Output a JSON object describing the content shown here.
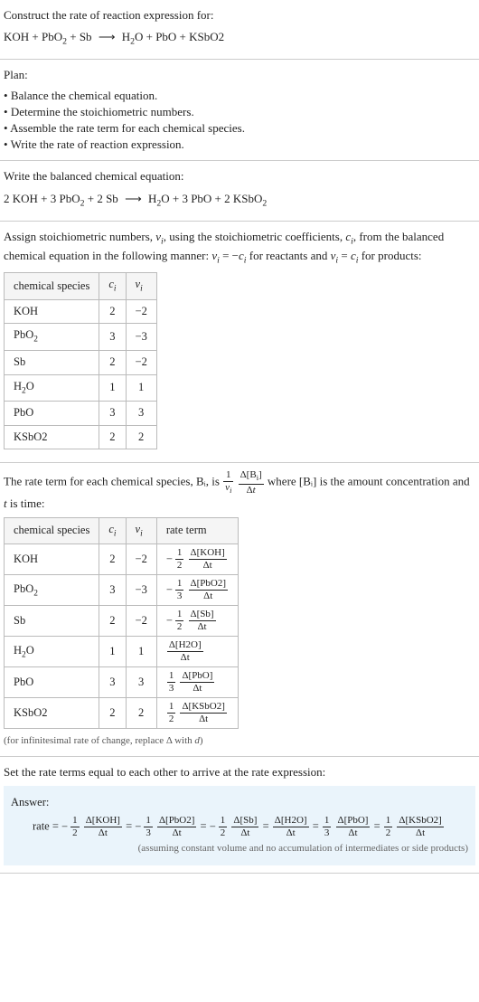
{
  "intro": {
    "construct": "Construct the rate of reaction expression for:",
    "equation": "KOH + PbO₂ + Sb ⟶ H₂O + PbO + KSbO2"
  },
  "plan": {
    "heading": "Plan:",
    "items": [
      "Balance the chemical equation.",
      "Determine the stoichiometric numbers.",
      "Assemble the rate term for each chemical species.",
      "Write the rate of reaction expression."
    ]
  },
  "balanced": {
    "heading": "Write the balanced chemical equation:",
    "equation": "2 KOH + 3 PbO₂ + 2 Sb ⟶ H₂O + 3 PbO + 2 KSbO₂"
  },
  "stoich": {
    "intro1": "Assign stoichiometric numbers, νᵢ, using the stoichiometric coefficients, cᵢ, from the balanced chemical equation in the following manner: νᵢ = −cᵢ for reactants and νᵢ = cᵢ for products:",
    "headers": [
      "chemical species",
      "cᵢ",
      "νᵢ"
    ],
    "rows": [
      {
        "sp": "KOH",
        "c": "2",
        "v": "−2"
      },
      {
        "sp": "PbO₂",
        "c": "3",
        "v": "−3"
      },
      {
        "sp": "Sb",
        "c": "2",
        "v": "−2"
      },
      {
        "sp": "H₂O",
        "c": "1",
        "v": "1"
      },
      {
        "sp": "PbO",
        "c": "3",
        "v": "3"
      },
      {
        "sp": "KSbO2",
        "c": "2",
        "v": "2"
      }
    ]
  },
  "rateterms": {
    "intro_a": "The rate term for each chemical species, Bᵢ, is ",
    "intro_b": " where [Bᵢ] is the amount concentration and ",
    "intro_c": " is time:",
    "t_var": "t",
    "headers": [
      "chemical species",
      "cᵢ",
      "νᵢ",
      "rate term"
    ],
    "rows": [
      {
        "sp": "KOH",
        "c": "2",
        "v": "−2",
        "sign": "−",
        "coef_num": "1",
        "coef_den": "2",
        "conc": "Δ[KOH]",
        "over": "Δt"
      },
      {
        "sp": "PbO₂",
        "c": "3",
        "v": "−3",
        "sign": "−",
        "coef_num": "1",
        "coef_den": "3",
        "conc": "Δ[PbO2]",
        "over": "Δt"
      },
      {
        "sp": "Sb",
        "c": "2",
        "v": "−2",
        "sign": "−",
        "coef_num": "1",
        "coef_den": "2",
        "conc": "Δ[Sb]",
        "over": "Δt"
      },
      {
        "sp": "H₂O",
        "c": "1",
        "v": "1",
        "sign": "",
        "coef_num": "",
        "coef_den": "",
        "conc": "Δ[H2O]",
        "over": "Δt"
      },
      {
        "sp": "PbO",
        "c": "3",
        "v": "3",
        "sign": "",
        "coef_num": "1",
        "coef_den": "3",
        "conc": "Δ[PbO]",
        "over": "Δt"
      },
      {
        "sp": "KSbO2",
        "c": "2",
        "v": "2",
        "sign": "",
        "coef_num": "1",
        "coef_den": "2",
        "conc": "Δ[KSbO2]",
        "over": "Δt"
      }
    ],
    "footnote": "(for infinitesimal rate of change, replace Δ with d)"
  },
  "final": {
    "heading": "Set the rate terms equal to each other to arrive at the rate expression:",
    "answer_label": "Answer:",
    "rate_prefix": "rate = ",
    "terms": [
      {
        "sign": "−",
        "coef_num": "1",
        "coef_den": "2",
        "conc": "Δ[KOH]",
        "over": "Δt"
      },
      {
        "sign": "−",
        "coef_num": "1",
        "coef_den": "3",
        "conc": "Δ[PbO2]",
        "over": "Δt"
      },
      {
        "sign": "−",
        "coef_num": "1",
        "coef_den": "2",
        "conc": "Δ[Sb]",
        "over": "Δt"
      },
      {
        "sign": "",
        "coef_num": "",
        "coef_den": "",
        "conc": "Δ[H2O]",
        "over": "Δt"
      },
      {
        "sign": "",
        "coef_num": "1",
        "coef_den": "3",
        "conc": "Δ[PbO]",
        "over": "Δt"
      },
      {
        "sign": "",
        "coef_num": "1",
        "coef_den": "2",
        "conc": "Δ[KSbO2]",
        "over": "Δt"
      }
    ],
    "eq": " = ",
    "assume": "(assuming constant volume and no accumulation of intermediates or side products)"
  }
}
